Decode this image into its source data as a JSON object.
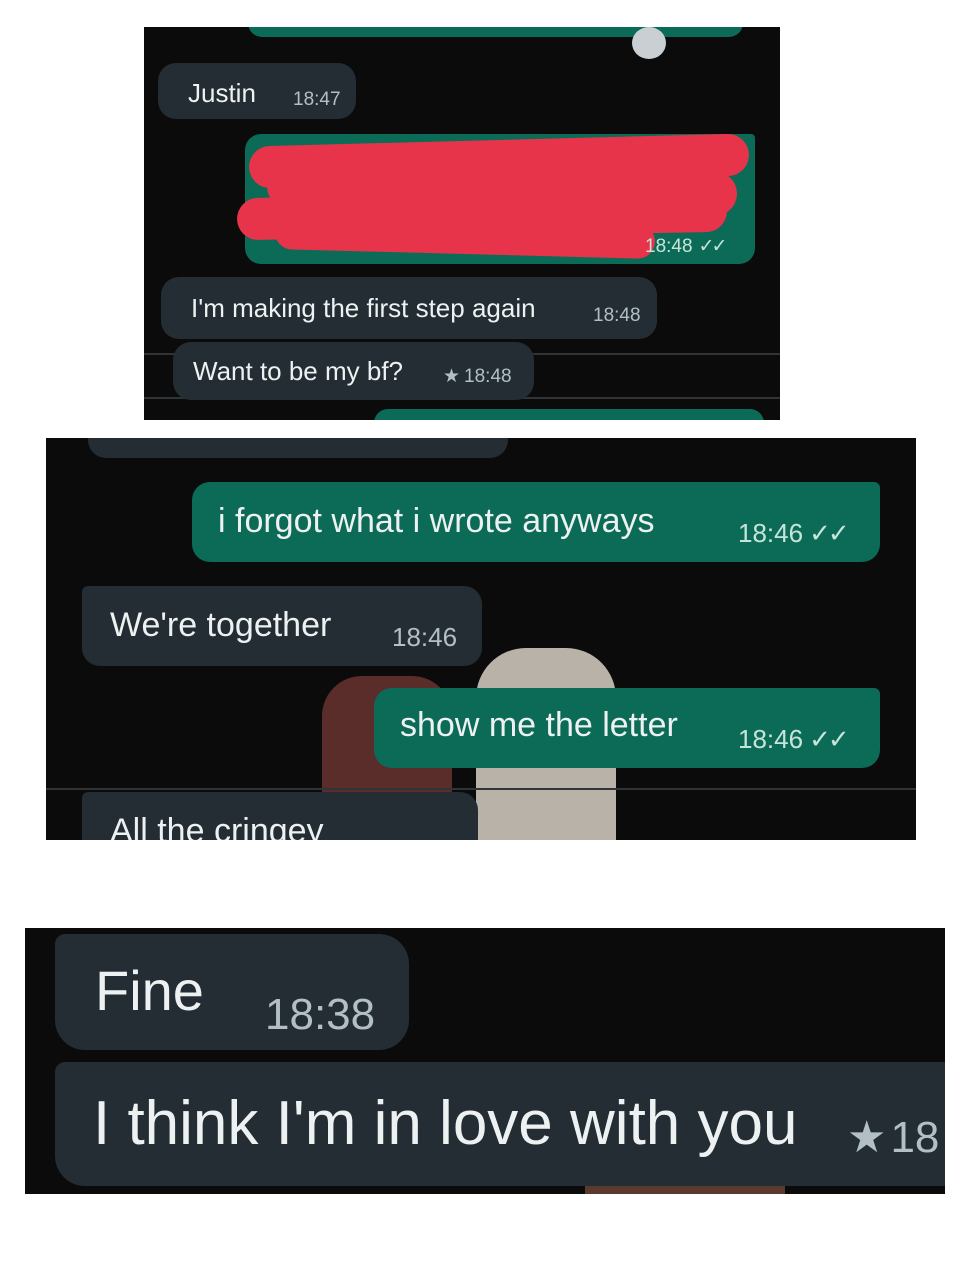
{
  "panels": {
    "top": {
      "messages": [
        {
          "text": "Justin",
          "time": "18:47",
          "direction": "incoming"
        },
        {
          "text": "",
          "time": "18:48",
          "direction": "outgoing",
          "redacted": true,
          "ticks": "✓✓"
        },
        {
          "text": "I'm making the first step again",
          "time": "18:48",
          "direction": "incoming"
        },
        {
          "text": "Want to be my bf?",
          "time": "18:48",
          "direction": "incoming",
          "starred": true
        }
      ]
    },
    "middle": {
      "messages": [
        {
          "text": "i forgot what i wrote anyways",
          "time": "18:46",
          "direction": "outgoing",
          "ticks": "✓✓"
        },
        {
          "text": "We're together",
          "time": "18:46",
          "direction": "incoming"
        },
        {
          "text": "show me the letter",
          "time": "18:46",
          "direction": "outgoing",
          "ticks": "✓✓"
        },
        {
          "text": "All the cringey",
          "time": "",
          "direction": "incoming",
          "clipped": true
        }
      ]
    },
    "bottom": {
      "messages": [
        {
          "text": "Fine",
          "time": "18:38",
          "direction": "incoming"
        },
        {
          "text": "I think I'm in love with you",
          "time": "18",
          "direction": "incoming",
          "starred": true
        }
      ]
    }
  },
  "icons": {
    "star": "★",
    "read_ticks": "✓✓"
  },
  "colors": {
    "panel_bg": "#0b0b0c",
    "incoming_bubble": "#232d33",
    "outgoing_bubble": "#0c6b56",
    "redaction": "#e8344b"
  }
}
